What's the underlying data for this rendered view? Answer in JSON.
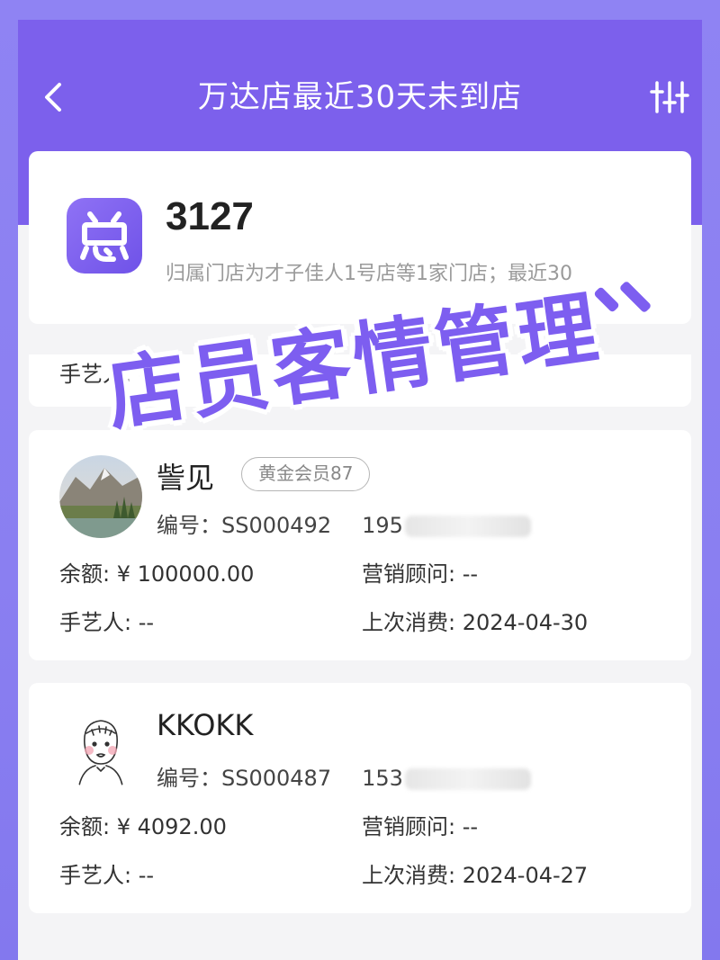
{
  "nav": {
    "title": "万达店最近30天未到店"
  },
  "summary": {
    "count": "3127",
    "description": "归属门店为才子佳人1号店等1家门店；最近30"
  },
  "overlay": {
    "text": "店员客情管理"
  },
  "partial_card": {
    "craftsman_label": "手艺人: --"
  },
  "members": [
    {
      "name": "訾见",
      "level": "黄金会员87",
      "id_label": "编号：",
      "id": "SS000492",
      "phone_prefix": "195",
      "balance": "余额: ¥ 100000.00",
      "consultant": "营销顾问: --",
      "craftsman": "手艺人: --",
      "last_visit": "上次消费: 2024-04-30"
    },
    {
      "name": "KKOKK",
      "level": "",
      "id_label": "编号：",
      "id": "SS000487",
      "phone_prefix": "153",
      "balance": "余额: ¥ 4092.00",
      "consultant": "营销顾问: --",
      "craftsman": "手艺人: --",
      "last_visit": "上次消费: 2024-04-27"
    }
  ],
  "colors": {
    "header": "#7c60ec",
    "accent": "#7d5ef0",
    "background": "#f4f4f6"
  }
}
